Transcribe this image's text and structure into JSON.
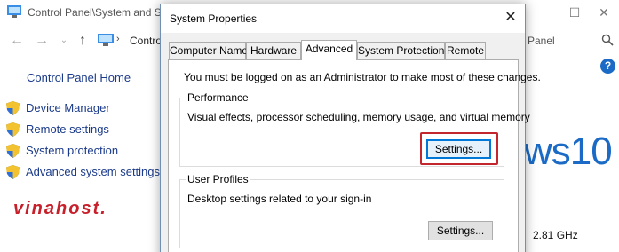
{
  "background_window": {
    "title": "Control Panel\\System and Se",
    "address_text": "Contro",
    "address_right": "Panel",
    "sidebar": {
      "home": "Control Panel Home",
      "links": [
        {
          "label": "Device Manager"
        },
        {
          "label": "Remote settings"
        },
        {
          "label": "System protection"
        },
        {
          "label": "Advanced system settings"
        }
      ]
    },
    "windows_logo_text": "ws10",
    "processor_speed": "2.81 GHz",
    "help_glyph": "?"
  },
  "watermark": "vinahost.",
  "dialog": {
    "title": "System Properties",
    "close_glyph": "✕",
    "tabs": [
      {
        "label": "Computer Name"
      },
      {
        "label": "Hardware"
      },
      {
        "label": "Advanced"
      },
      {
        "label": "System Protection"
      },
      {
        "label": "Remote"
      }
    ],
    "active_tab": "Advanced",
    "admin_notice": "You must be logged on as an Administrator to make most of these changes.",
    "performance": {
      "title": "Performance",
      "description": "Visual effects, processor scheduling, memory usage, and virtual memory",
      "button": "Settings..."
    },
    "user_profiles": {
      "title": "User Profiles",
      "description": "Desktop settings related to your sign-in",
      "button": "Settings..."
    }
  },
  "colors": {
    "link": "#1a3a8a",
    "accent": "#1b6bc6",
    "highlight": "#c4262e",
    "focus": "#0078d7"
  }
}
